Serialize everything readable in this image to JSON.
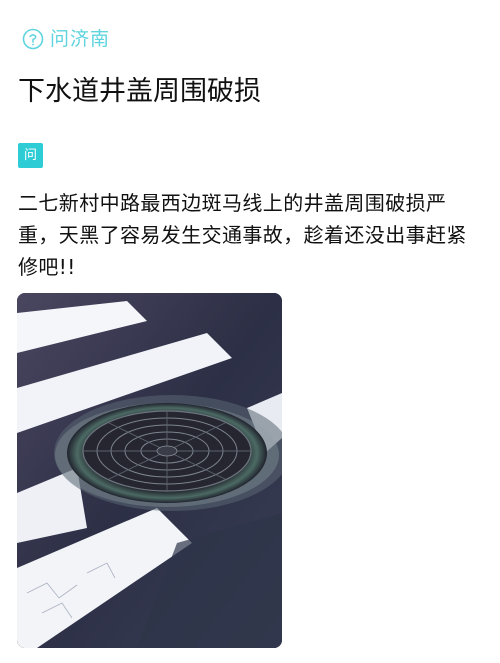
{
  "header": {
    "brand_name": "问济南",
    "logo_icon": "wen-jinan-logo-icon",
    "accent_color": "#5fd4df"
  },
  "post": {
    "title": "下水道井盖周围破损",
    "badge": "问",
    "badge_color": "#2ecdd6",
    "body": "二七新村中路最西边斑马线上的井盖周围破损严重，天黑了容易发生交通事故，趁着还没出事赶紧修吧!!",
    "photo": {
      "subject": "manhole-cover-photo"
    }
  }
}
